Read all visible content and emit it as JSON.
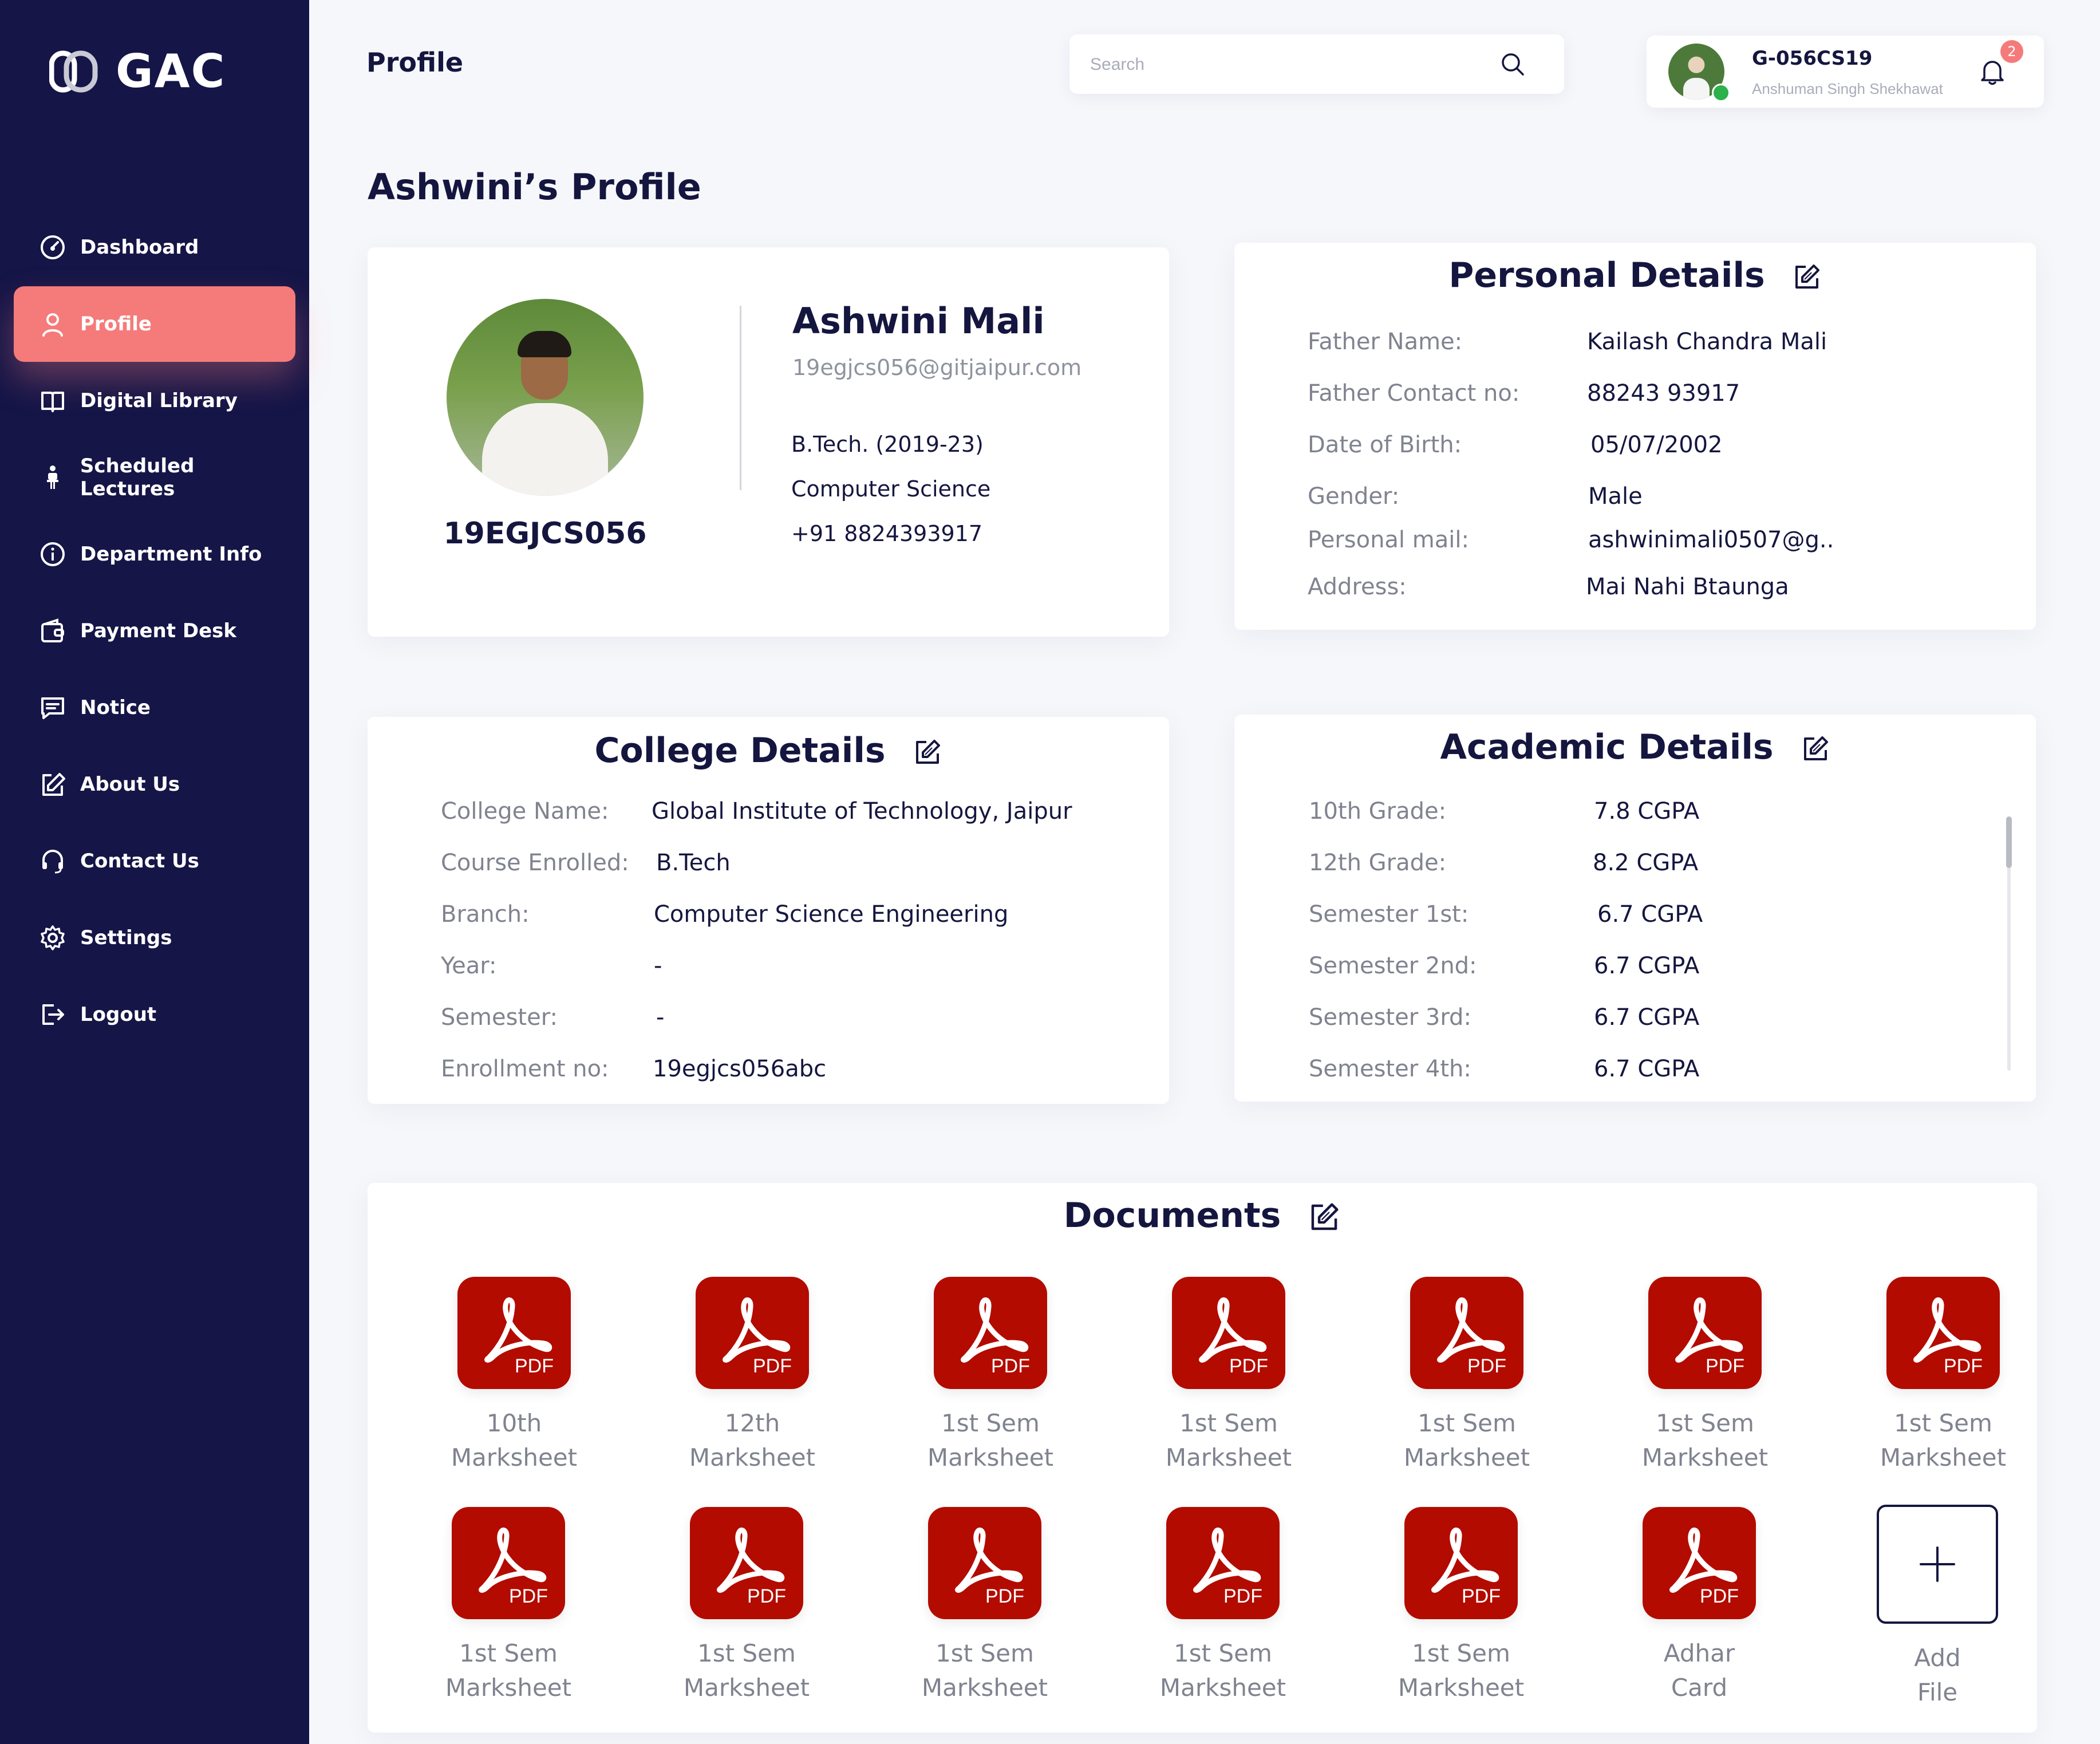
{
  "app": {
    "logo_text": "GAC"
  },
  "sidebar": {
    "items": [
      {
        "label": "Dashboard",
        "icon": "dashboard-icon"
      },
      {
        "label": "Profile",
        "icon": "user-icon",
        "active": true
      },
      {
        "label": "Digital Library",
        "icon": "book-icon"
      },
      {
        "label": "Scheduled Lectures",
        "icon": "lecture-icon"
      },
      {
        "label": "Department Info",
        "icon": "info-icon"
      },
      {
        "label": "Payment Desk",
        "icon": "wallet-icon"
      },
      {
        "label": "Notice",
        "icon": "message-icon"
      },
      {
        "label": "About Us",
        "icon": "edit-icon"
      },
      {
        "label": "Contact Us",
        "icon": "headset-icon"
      },
      {
        "label": "Settings",
        "icon": "gear-icon"
      },
      {
        "label": "Logout",
        "icon": "logout-icon"
      }
    ]
  },
  "header": {
    "title": "Profile",
    "search_placeholder": "Search",
    "user_id": "G-056CS19",
    "user_name": "Anshuman  Singh Shekhawat",
    "notification_count": "2"
  },
  "page": {
    "heading": "Ashwini’s Profile"
  },
  "profile": {
    "roll_no": "19EGJCS056",
    "name": "Ashwini Mali",
    "email": "19egjcs056@gitjaipur.com",
    "program": "B.Tech. (2019-23)",
    "department": "Computer Science",
    "phone": "+91 8824393917"
  },
  "personal": {
    "title": "Personal Details",
    "rows": [
      {
        "label": "Father Name:",
        "value": "Kailash Chandra Mali"
      },
      {
        "label": "Father Contact no:",
        "value": "88243 93917"
      },
      {
        "label": "Date of Birth:",
        "value": "05/07/2002"
      },
      {
        "label": "Gender:",
        "value": "Male"
      },
      {
        "label": "Personal mail:",
        "value": "ashwinimali0507@g.."
      },
      {
        "label": "Address:",
        "value": "Mai Nahi Btaunga"
      }
    ]
  },
  "college": {
    "title": "College Details",
    "rows": [
      {
        "label": "College Name:",
        "value": "Global Institute of Technology, Jaipur"
      },
      {
        "label": "Course Enrolled:",
        "value": "B.Tech"
      },
      {
        "label": "Branch:",
        "value": "Computer Science Engineering"
      },
      {
        "label": "Year:",
        "value": "-"
      },
      {
        "label": "Semester:",
        "value": "-"
      },
      {
        "label": "Enrollment no:",
        "value": "19egjcs056abc"
      }
    ]
  },
  "academic": {
    "title": "Academic Details",
    "rows": [
      {
        "label": "10th Grade:",
        "value": "7.8 CGPA"
      },
      {
        "label": "12th Grade:",
        "value": "8.2 CGPA"
      },
      {
        "label": "Semester 1st:",
        "value": "6.7 CGPA"
      },
      {
        "label": "Semester 2nd:",
        "value": "6.7 CGPA"
      },
      {
        "label": "Semester 3rd:",
        "value": "6.7 CGPA"
      },
      {
        "label": "Semester 4th:",
        "value": "6.7 CGPA"
      }
    ]
  },
  "documents": {
    "title": "Documents",
    "pdf_badge": "PDF",
    "items": [
      {
        "line1": "10th",
        "line2": "Marksheet"
      },
      {
        "line1": "12th",
        "line2": "Marksheet"
      },
      {
        "line1": "1st Sem",
        "line2": "Marksheet"
      },
      {
        "line1": "1st Sem",
        "line2": "Marksheet"
      },
      {
        "line1": "1st Sem",
        "line2": "Marksheet"
      },
      {
        "line1": "1st Sem",
        "line2": "Marksheet"
      },
      {
        "line1": "1st Sem",
        "line2": "Marksheet"
      },
      {
        "line1": "1st Sem",
        "line2": "Marksheet"
      },
      {
        "line1": "1st Sem",
        "line2": "Marksheet"
      },
      {
        "line1": "1st Sem",
        "line2": "Marksheet"
      },
      {
        "line1": "1st Sem",
        "line2": "Marksheet"
      },
      {
        "line1": "1st Sem",
        "line2": "Marksheet"
      },
      {
        "line1": "Adhar",
        "line2": "Card"
      }
    ],
    "add": {
      "line1": "Add",
      "line2": "File"
    }
  },
  "colors": {
    "sidebar": "#151547",
    "accent": "#f47b7a",
    "pdf": "#b30b00",
    "background": "#f6f7fb"
  }
}
